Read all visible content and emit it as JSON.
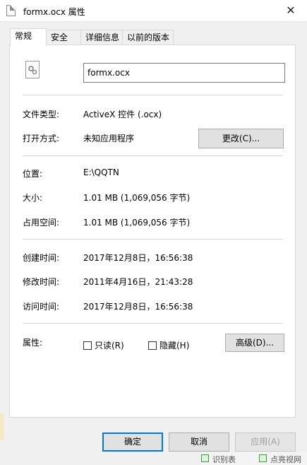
{
  "window": {
    "title": "formx.ocx 属性",
    "close_glyph": "✕"
  },
  "tabs": [
    {
      "label": "常规",
      "active": true
    },
    {
      "label": "安全",
      "active": false
    },
    {
      "label": "详细信息",
      "active": false
    },
    {
      "label": "以前的版本",
      "active": false
    }
  ],
  "general": {
    "file_name": "formx.ocx",
    "file_type_label": "文件类型:",
    "file_type_value": "ActiveX 控件 (.ocx)",
    "opens_with_label": "打开方式:",
    "opens_with_value": "未知应用程序",
    "change_button": "更改(C)...",
    "location_label": "位置:",
    "location_value": "E:\\QQTN",
    "size_label": "大小:",
    "size_value": "1.01 MB (1,069,056 字节)",
    "size_on_disk_label": "占用空间:",
    "size_on_disk_value": "1.01 MB (1,069,056 字节)",
    "created_label": "创建时间:",
    "created_value": "2017年12月8日，16:56:38",
    "modified_label": "修改时间:",
    "modified_value": "2011年4月16日，21:43:28",
    "accessed_label": "访问时间:",
    "accessed_value": "2017年12月8日，16:56:38",
    "attributes_label": "属性:",
    "readonly_label": "只读(R)",
    "readonly_checked": false,
    "hidden_label": "隐藏(H)",
    "hidden_checked": false,
    "advanced_button": "高级(D)..."
  },
  "footer": {
    "ok": "确定",
    "cancel": "取消",
    "apply": "应用(A)"
  },
  "background": {
    "item1": "识别表",
    "item2": "点亮视网"
  },
  "colors": {
    "accent": "#0078d7",
    "panel_bg": "#ffffff",
    "dialog_bg": "#f0f0f0",
    "button_bg": "#e1e1e1"
  }
}
